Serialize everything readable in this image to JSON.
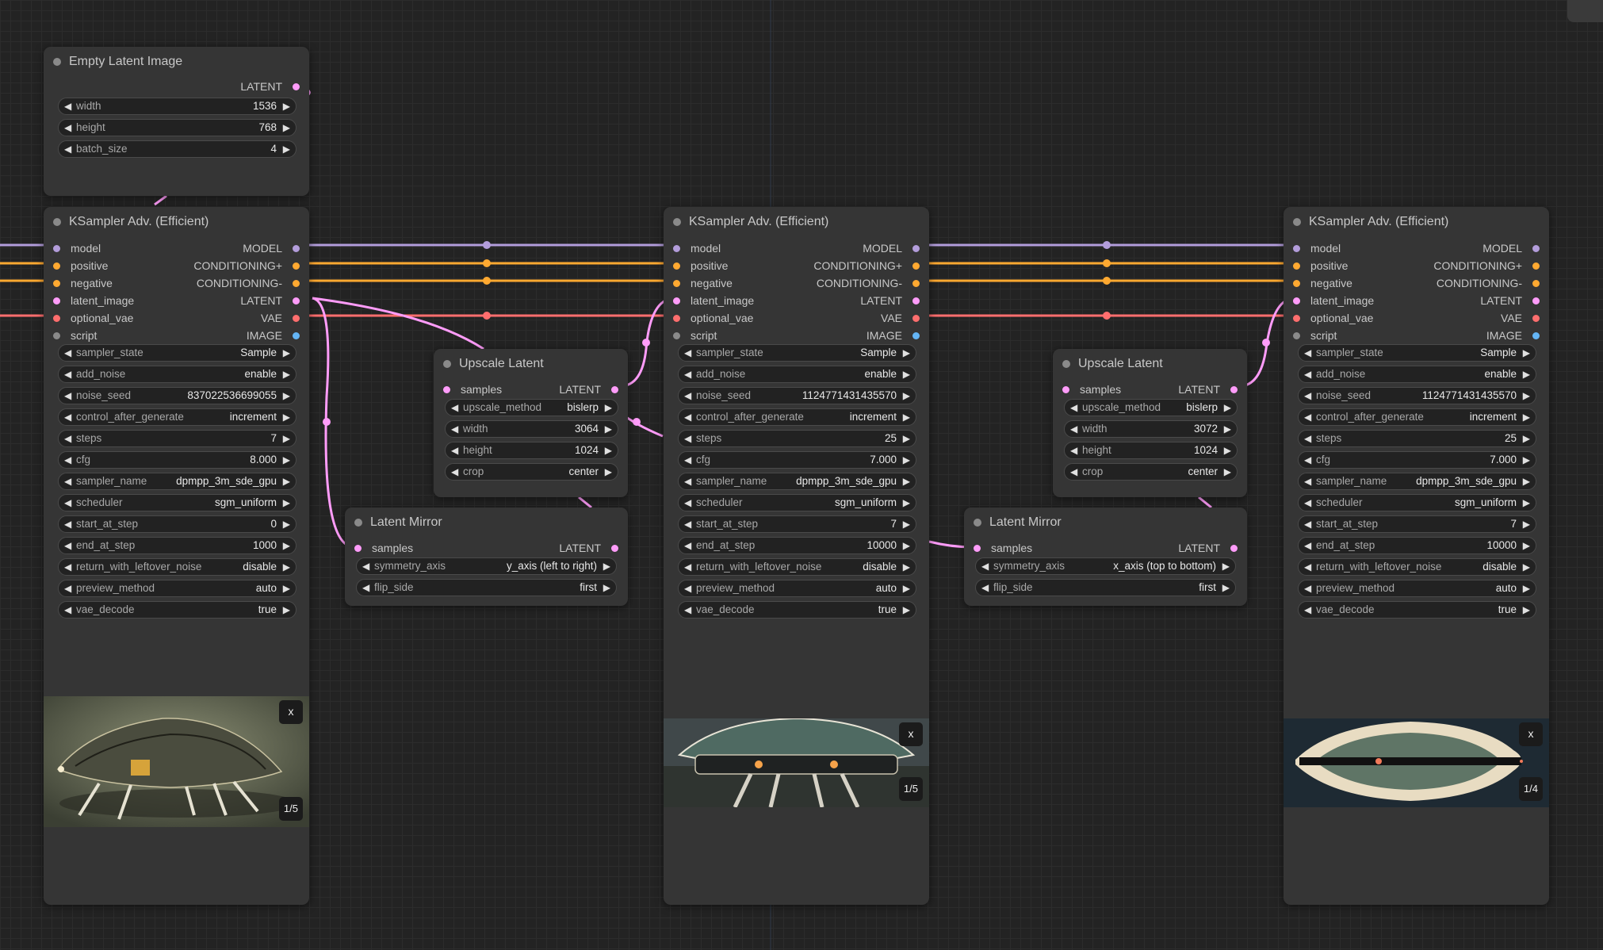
{
  "colors": {
    "canvas": "#232323",
    "node_bg": "#353535",
    "model": "#b39ddb",
    "conditioning": "#ffa931",
    "latent": "#ff9cf9",
    "vae": "#ff6e6e",
    "image": "#64b5f6",
    "script": "#8a8a8a"
  },
  "empty_latent": {
    "title": "Empty Latent Image",
    "output": "LATENT",
    "widgets": [
      {
        "label": "width",
        "value": "1536"
      },
      {
        "label": "height",
        "value": "768"
      },
      {
        "label": "batch_size",
        "value": "4"
      }
    ]
  },
  "ksamplers": [
    {
      "title": "KSampler Adv. (Efficient)",
      "inputs": [
        "model",
        "positive",
        "negative",
        "latent_image",
        "optional_vae",
        "script"
      ],
      "outputs": [
        "MODEL",
        "CONDITIONING+",
        "CONDITIONING-",
        "LATENT",
        "VAE",
        "IMAGE"
      ],
      "widgets": [
        {
          "label": "sampler_state",
          "value": "Sample"
        },
        {
          "label": "add_noise",
          "value": "enable"
        },
        {
          "label": "noise_seed",
          "value": "837022536699055"
        },
        {
          "label": "control_after_generate",
          "value": "increment"
        },
        {
          "label": "steps",
          "value": "7"
        },
        {
          "label": "cfg",
          "value": "8.000"
        },
        {
          "label": "sampler_name",
          "value": "dpmpp_3m_sde_gpu"
        },
        {
          "label": "scheduler",
          "value": "sgm_uniform"
        },
        {
          "label": "start_at_step",
          "value": "0"
        },
        {
          "label": "end_at_step",
          "value": "1000"
        },
        {
          "label": "return_with_leftover_noise",
          "value": "disable"
        },
        {
          "label": "preview_method",
          "value": "auto"
        },
        {
          "label": "vae_decode",
          "value": "true"
        }
      ],
      "preview": {
        "close": "x",
        "counter": "1/5",
        "subject": "side-view-ship"
      }
    },
    {
      "title": "KSampler Adv. (Efficient)",
      "inputs": [
        "model",
        "positive",
        "negative",
        "latent_image",
        "optional_vae",
        "script"
      ],
      "outputs": [
        "MODEL",
        "CONDITIONING+",
        "CONDITIONING-",
        "LATENT",
        "VAE",
        "IMAGE"
      ],
      "widgets": [
        {
          "label": "sampler_state",
          "value": "Sample"
        },
        {
          "label": "add_noise",
          "value": "enable"
        },
        {
          "label": "noise_seed",
          "value": "1124771431435570"
        },
        {
          "label": "control_after_generate",
          "value": "increment"
        },
        {
          "label": "steps",
          "value": "25"
        },
        {
          "label": "cfg",
          "value": "7.000"
        },
        {
          "label": "sampler_name",
          "value": "dpmpp_3m_sde_gpu"
        },
        {
          "label": "scheduler",
          "value": "sgm_uniform"
        },
        {
          "label": "start_at_step",
          "value": "7"
        },
        {
          "label": "end_at_step",
          "value": "10000"
        },
        {
          "label": "return_with_leftover_noise",
          "value": "disable"
        },
        {
          "label": "preview_method",
          "value": "auto"
        },
        {
          "label": "vae_decode",
          "value": "true"
        }
      ],
      "preview": {
        "close": "x",
        "counter": "1/5",
        "subject": "front-view-ship"
      }
    },
    {
      "title": "KSampler Adv. (Efficient)",
      "inputs": [
        "model",
        "positive",
        "negative",
        "latent_image",
        "optional_vae",
        "script"
      ],
      "outputs": [
        "MODEL",
        "CONDITIONING+",
        "CONDITIONING-",
        "LATENT",
        "VAE",
        "IMAGE"
      ],
      "widgets": [
        {
          "label": "sampler_state",
          "value": "Sample"
        },
        {
          "label": "add_noise",
          "value": "enable"
        },
        {
          "label": "noise_seed",
          "value": "1124771431435570"
        },
        {
          "label": "control_after_generate",
          "value": "increment"
        },
        {
          "label": "steps",
          "value": "25"
        },
        {
          "label": "cfg",
          "value": "7.000"
        },
        {
          "label": "sampler_name",
          "value": "dpmpp_3m_sde_gpu"
        },
        {
          "label": "scheduler",
          "value": "sgm_uniform"
        },
        {
          "label": "start_at_step",
          "value": "7"
        },
        {
          "label": "end_at_step",
          "value": "10000"
        },
        {
          "label": "return_with_leftover_noise",
          "value": "disable"
        },
        {
          "label": "preview_method",
          "value": "auto"
        },
        {
          "label": "vae_decode",
          "value": "true"
        }
      ],
      "preview": {
        "close": "x",
        "counter": "1/4",
        "subject": "top-view-ship"
      }
    }
  ],
  "upscale_latents": [
    {
      "title": "Upscale Latent",
      "input": "samples",
      "output": "LATENT",
      "widgets": [
        {
          "label": "upscale_method",
          "value": "bislerp"
        },
        {
          "label": "width",
          "value": "3064"
        },
        {
          "label": "height",
          "value": "1024"
        },
        {
          "label": "crop",
          "value": "center"
        }
      ]
    },
    {
      "title": "Upscale Latent",
      "input": "samples",
      "output": "LATENT",
      "widgets": [
        {
          "label": "upscale_method",
          "value": "bislerp"
        },
        {
          "label": "width",
          "value": "3072"
        },
        {
          "label": "height",
          "value": "1024"
        },
        {
          "label": "crop",
          "value": "center"
        }
      ]
    }
  ],
  "latent_mirrors": [
    {
      "title": "Latent Mirror",
      "input": "samples",
      "output": "LATENT",
      "widgets": [
        {
          "label": "symmetry_axis",
          "value": "y_axis (left to right)"
        },
        {
          "label": "flip_side",
          "value": "first"
        }
      ]
    },
    {
      "title": "Latent Mirror",
      "input": "samples",
      "output": "LATENT",
      "widgets": [
        {
          "label": "symmetry_axis",
          "value": "x_axis (top to bottom)"
        },
        {
          "label": "flip_side",
          "value": "first"
        }
      ]
    }
  ]
}
